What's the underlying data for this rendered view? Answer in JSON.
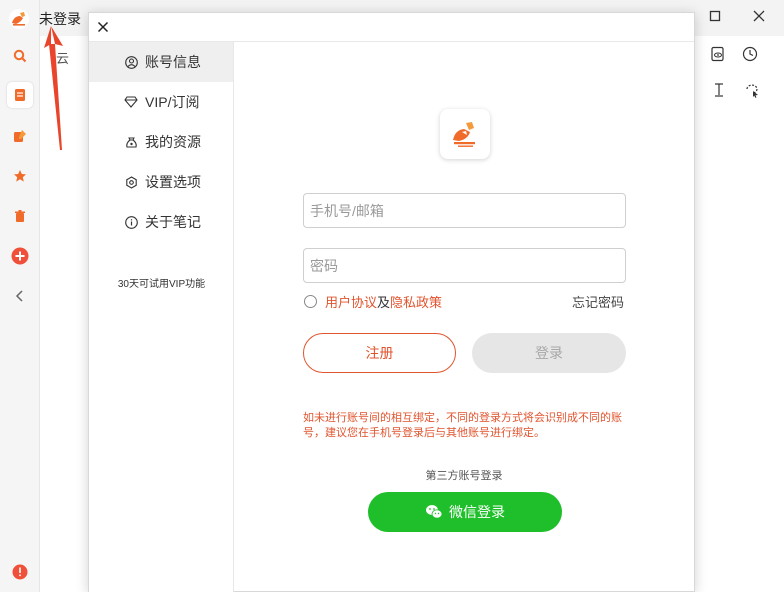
{
  "app": {
    "user_status": "未登录",
    "bg_partial_text": "云",
    "colors": {
      "accent": "#e0542e",
      "wechat": "#1fbf2b",
      "logo": "#f06a2a"
    }
  },
  "left_bar": {
    "icons": [
      "search-icon",
      "notes-icon",
      "edit-icon",
      "star-icon",
      "trash-icon",
      "add-icon",
      "chevron-left-icon",
      "alert-icon"
    ]
  },
  "dialog": {
    "nav": [
      {
        "label": "账号信息",
        "icon": "user-circle-icon"
      },
      {
        "label": "VIP/订阅",
        "icon": "diamond-icon"
      },
      {
        "label": "我的资源",
        "icon": "bag-icon"
      },
      {
        "label": "设置选项",
        "icon": "settings-icon"
      },
      {
        "label": "关于笔记",
        "icon": "info-icon"
      }
    ],
    "vip_trial_note": "30天可试用VIP功能",
    "login": {
      "phone_placeholder": "手机号/邮箱",
      "password_placeholder": "密码",
      "user_agreement": "用户协议",
      "and": "及",
      "privacy_policy": "隐私政策",
      "forgot_password": "忘记密码",
      "register_label": "注册",
      "login_label": "登录",
      "notice": "如未进行账号间的相互绑定，不同的登录方式将会识别成不同的账号，建议您在手机号登录后与其他账号进行绑定。",
      "third_party_title": "第三方账号登录",
      "wechat_login_label": "微信登录"
    }
  }
}
